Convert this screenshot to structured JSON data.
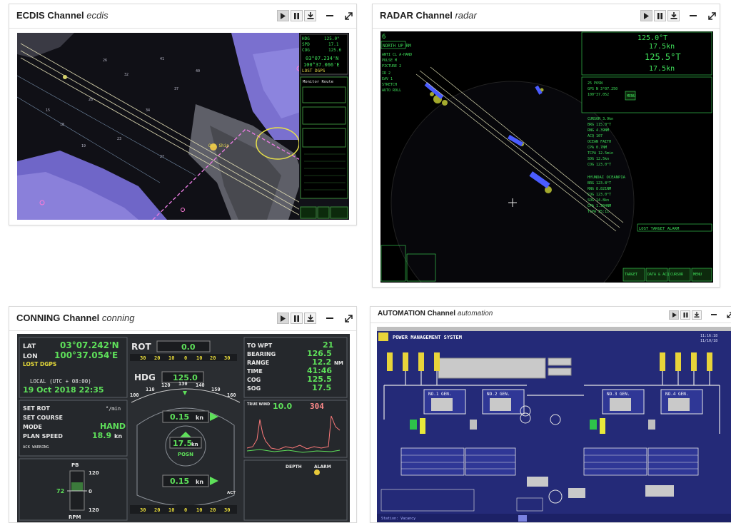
{
  "panels": {
    "ecdis": {
      "title": "ECDIS Channel",
      "sub": "ecdis"
    },
    "radar": {
      "title": "RADAR Channel",
      "sub": "radar"
    },
    "conning": {
      "title": "CONNING Channel",
      "sub": "conning"
    },
    "automation": {
      "title": "AUTOMATION Channel",
      "sub": "automation"
    }
  },
  "controls": [
    "play-icon",
    "pause-icon",
    "download-icon",
    "minimize-icon",
    "expand-icon"
  ],
  "ecdis_screen": {
    "hdg_label": "HDG",
    "hdg": "125.0°",
    "spd_label": "SPD",
    "spd": "17.1",
    "cog_label": "COG",
    "cog": "125.6",
    "lat": "03°07.234'N",
    "lon": "100°37.066'E",
    "lost": "LOST DGPS",
    "monitor_title": "Monitor Route"
  },
  "radar_screen": {
    "range": "6",
    "mode": "NORTH UP RM",
    "hdg": "125.0°T",
    "spd": "17.5kn",
    "cog": "125.5°T",
    "sog": "17.5kn",
    "target_name": "HYUNDAI OCEANPIA",
    "lost": "LOST TARGET ALARM",
    "menu": "MENU",
    "buttons": [
      "TARGET",
      "DATA & ACQ",
      "CURSOR",
      "MENU"
    ]
  },
  "conning_screen": {
    "lat_label": "LAT",
    "lat": "03°07.242'N",
    "lon_label": "LON",
    "lon": "100°37.054'E",
    "lost": "LOST DGPS",
    "local_label": "LOCAL (UTC + 08:00)",
    "local_time": "19 Oct 2018 22:35",
    "rot_label": "ROT",
    "rot": "0.0",
    "rot_scale": [
      "30",
      "20",
      "10",
      "0",
      "10",
      "20",
      "30"
    ],
    "hdg_label": "HDG",
    "hdg": "125.0",
    "hdg_scale": [
      "100",
      "110",
      "120",
      "130",
      "140",
      "150",
      "160"
    ],
    "to_wpt_label": "TO WPT",
    "to_wpt": "21",
    "bearing_label": "BEARING",
    "bearing": "126.5",
    "range_label": "RANGE",
    "range": "12.2",
    "range_unit": "NM",
    "time_label": "TIME",
    "time": "41:46",
    "cog_label": "COG",
    "cog": "125.5",
    "sog_label": "SOG",
    "sog": "17.5",
    "set_rot": "SET ROT",
    "set_rot_unit": "°/min",
    "set_course": "SET COURSE",
    "mode_label": "MODE",
    "mode": "HAND",
    "plan_speed_label": "PLAN SPEED",
    "plan_speed": "18.9",
    "plan_speed_unit": "kn",
    "ack": "ACK WARNING",
    "pb": "PB",
    "rpm": "RPM",
    "pb_val": "72",
    "pb_scale": [
      "120",
      "0",
      "120"
    ],
    "speed_fwd": "0.15",
    "speed_mid": "17.5",
    "speed_aft": "0.15",
    "posn": "POSN",
    "kn": "kn",
    "wind_label": "TRUE WIND",
    "wind": "10.0",
    "wind_dir": "304",
    "depth_label": "DEPTH",
    "alarm_label": "ALARM",
    "act_label": "ACT"
  },
  "automation_screen": {
    "title": "POWER MANAGEMENT SYSTEM",
    "time1": "11:16:18",
    "time2": "11/10/18",
    "gens": [
      "NO.1 GEN.",
      "NO.2 GEN.",
      "NO.3 GEN.",
      "NO.4 GEN."
    ],
    "footer": "Station: Vacancy"
  },
  "colors": {
    "green": "#3fe05a",
    "yellow": "#e5d84a",
    "chart_purple": "#7a6fd0",
    "automation_bg": "#242a78"
  }
}
